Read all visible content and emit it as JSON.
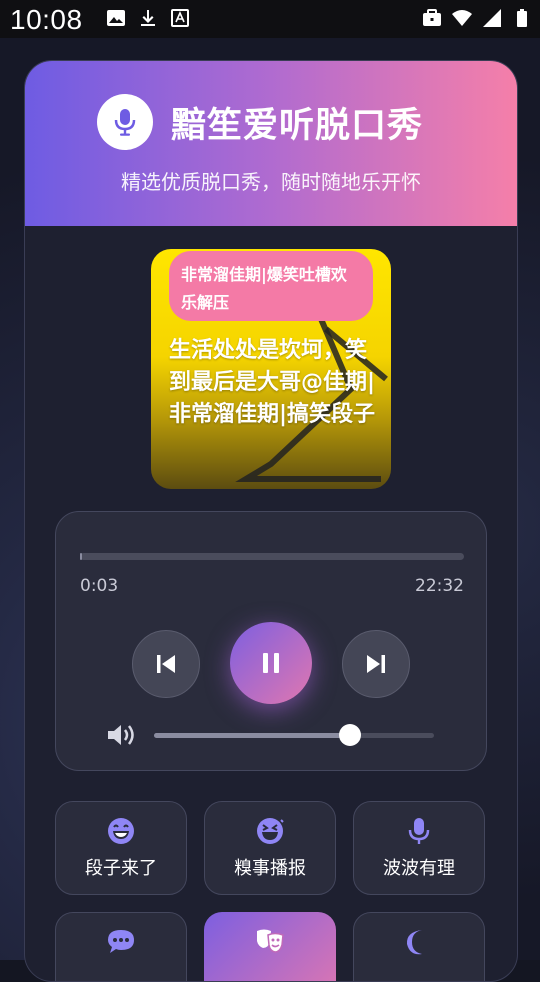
{
  "status_bar": {
    "time": "10:08",
    "left_icons": [
      "image-icon",
      "download-icon",
      "font-icon"
    ],
    "right_icons": [
      "briefcase-icon",
      "wifi-icon",
      "signal-icon",
      "battery-icon"
    ]
  },
  "header": {
    "title": "黯笙爱听脱口秀",
    "subtitle": "精选优质脱口秀，随时随地乐开怀",
    "icon": "microphone-icon"
  },
  "now_playing": {
    "tag": "非常溜佳期|爆笑吐槽欢乐解压",
    "title": "生活处处是坎坷，笑到最后是大哥@佳期|非常溜佳期|搞笑段子"
  },
  "player": {
    "current_time": "0:03",
    "total_time": "22:32",
    "progress": 0.002,
    "volume": 0.7,
    "state": "playing"
  },
  "categories": [
    {
      "label": "段子来了",
      "icon": "laugh-icon",
      "active": false
    },
    {
      "label": "糗事播报",
      "icon": "laugh-squint-icon",
      "active": false
    },
    {
      "label": "波波有理",
      "icon": "microphone-icon",
      "active": false
    },
    {
      "label": "",
      "icon": "comment-dots-icon",
      "active": false
    },
    {
      "label": "",
      "icon": "theater-masks-icon",
      "active": true
    },
    {
      "label": "",
      "icon": "moon-icon",
      "active": false
    }
  ],
  "colors": {
    "accent_start": "#7d5fe0",
    "accent_end": "#e077b0",
    "header_start": "#6e5ce3",
    "header_end": "#f57fa9",
    "icon_purple": "#8f86f5"
  }
}
